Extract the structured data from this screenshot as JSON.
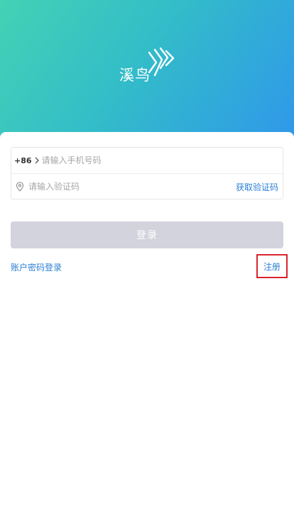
{
  "header": {
    "logo_text": "溪鸟",
    "gradient_start": "#44d2b4",
    "gradient_end": "#2f98ea"
  },
  "form": {
    "country_code": "+86",
    "phone_placeholder": "请输入手机号码",
    "code_placeholder": "请输入验证码",
    "get_code_label": "获取验证码",
    "login_label": "登录"
  },
  "links": {
    "password_login": "账户密码登录",
    "register": "注册"
  },
  "icons": {
    "country_chevron": "chevron-right-icon",
    "code_field": "location-pin-icon",
    "logo_mark": "feather-wing-icon"
  },
  "colors": {
    "link": "#2b7fd6",
    "login_disabled": "#d2d3dc",
    "highlight_border": "#d6252f"
  }
}
